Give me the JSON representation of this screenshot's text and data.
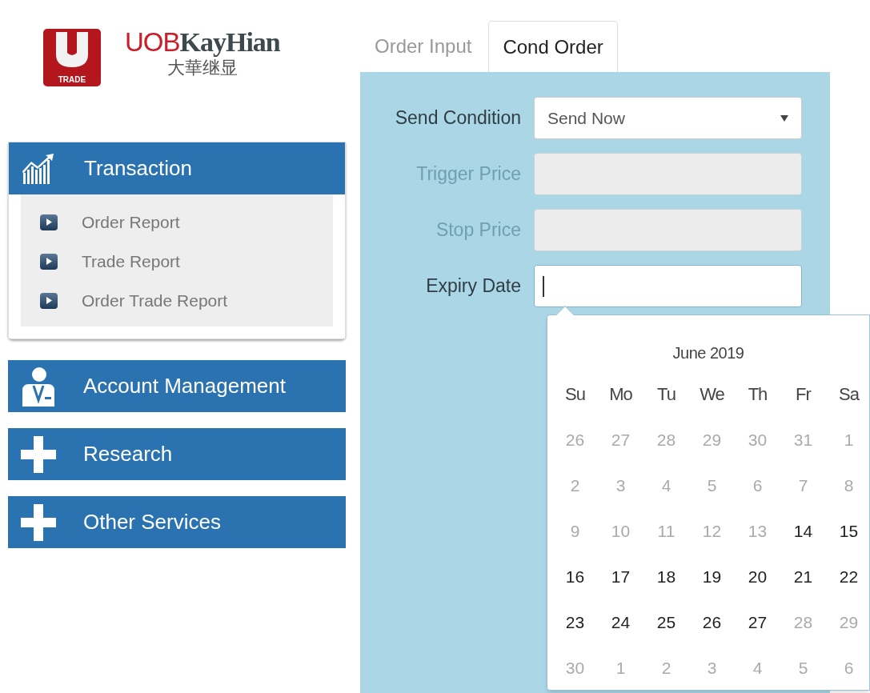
{
  "logo": {
    "badge": "TRADE",
    "brand_light": "UOB",
    "brand_bold": "KayHian",
    "chinese": "大華继显"
  },
  "sidebar": {
    "sections": [
      {
        "label": "Transaction",
        "expanded": true,
        "children": [
          {
            "label": "Order Report"
          },
          {
            "label": "Trade Report"
          },
          {
            "label": "Order Trade Report"
          }
        ]
      },
      {
        "label": "Account Management",
        "expanded": false
      },
      {
        "label": "Research",
        "expanded": false
      },
      {
        "label": "Other Services",
        "expanded": false
      }
    ]
  },
  "tabs": [
    {
      "label": "Order Input",
      "selected": false
    },
    {
      "label": "Cond Order",
      "selected": true
    }
  ],
  "form": {
    "fields": [
      {
        "label": "Send Condition",
        "kind": "select",
        "value": "Send Now",
        "disabled": false
      },
      {
        "label": "Trigger Price",
        "kind": "text",
        "disabled": true
      },
      {
        "label": "Stop Price",
        "kind": "text",
        "disabled": true
      },
      {
        "label": "Expiry Date",
        "kind": "date",
        "disabled": false,
        "focused": true
      }
    ]
  },
  "datepicker": {
    "title": "June 2019",
    "weekdays": [
      "Su",
      "Mo",
      "Tu",
      "We",
      "Th",
      "Fr",
      "Sa"
    ],
    "weeks": [
      [
        {
          "day": "26",
          "disabled": true
        },
        {
          "day": "27",
          "disabled": true
        },
        {
          "day": "28",
          "disabled": true
        },
        {
          "day": "29",
          "disabled": true
        },
        {
          "day": "30",
          "disabled": true
        },
        {
          "day": "31",
          "disabled": true
        },
        {
          "day": "1",
          "disabled": true
        }
      ],
      [
        {
          "day": "2",
          "disabled": true
        },
        {
          "day": "3",
          "disabled": true
        },
        {
          "day": "4",
          "disabled": true
        },
        {
          "day": "5",
          "disabled": true
        },
        {
          "day": "6",
          "disabled": true
        },
        {
          "day": "7",
          "disabled": true
        },
        {
          "day": "8",
          "disabled": true
        }
      ],
      [
        {
          "day": "9",
          "disabled": true
        },
        {
          "day": "10",
          "disabled": true
        },
        {
          "day": "11",
          "disabled": true
        },
        {
          "day": "12",
          "disabled": true
        },
        {
          "day": "13",
          "disabled": true
        },
        {
          "day": "14",
          "disabled": false
        },
        {
          "day": "15",
          "disabled": false
        }
      ],
      [
        {
          "day": "16",
          "disabled": false
        },
        {
          "day": "17",
          "disabled": false
        },
        {
          "day": "18",
          "disabled": false
        },
        {
          "day": "19",
          "disabled": false
        },
        {
          "day": "20",
          "disabled": false
        },
        {
          "day": "21",
          "disabled": false
        },
        {
          "day": "22",
          "disabled": false
        }
      ],
      [
        {
          "day": "23",
          "disabled": false
        },
        {
          "day": "24",
          "disabled": false
        },
        {
          "day": "25",
          "disabled": false
        },
        {
          "day": "26",
          "disabled": false
        },
        {
          "day": "27",
          "disabled": false
        },
        {
          "day": "28",
          "disabled": true
        },
        {
          "day": "29",
          "disabled": true
        }
      ],
      [
        {
          "day": "30",
          "disabled": true
        },
        {
          "day": "1",
          "disabled": true
        },
        {
          "day": "2",
          "disabled": true
        },
        {
          "day": "3",
          "disabled": true
        },
        {
          "day": "4",
          "disabled": true
        },
        {
          "day": "5",
          "disabled": true
        },
        {
          "day": "6",
          "disabled": true
        }
      ]
    ]
  }
}
